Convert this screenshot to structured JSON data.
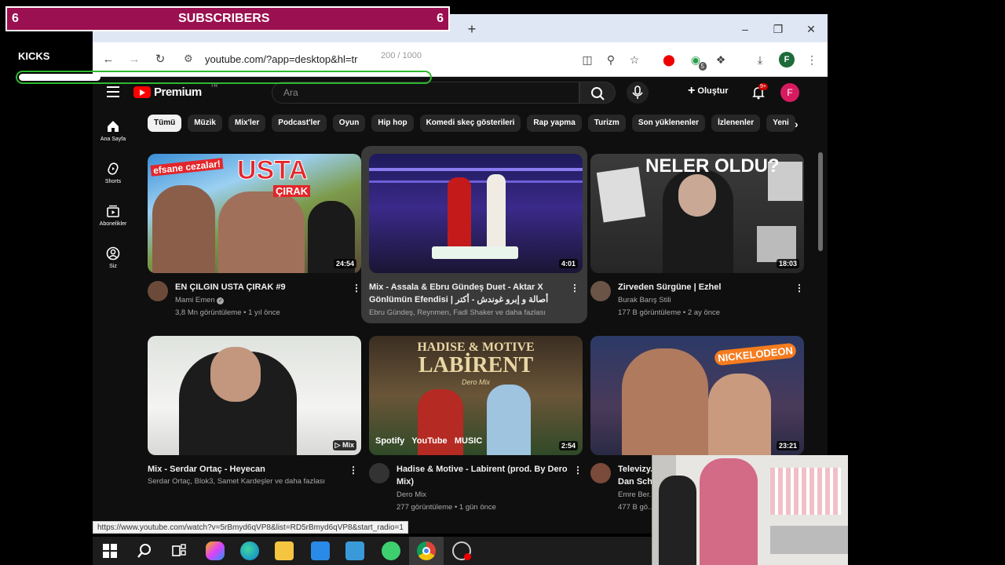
{
  "overlay": {
    "subscribers_label": "SUBSCRIBERS",
    "subscribers_left": "6",
    "subscribers_right": "6",
    "kicks_label": "KICKS",
    "kicks_count": "200 / 1000",
    "kicks_progress": 0.2
  },
  "browser": {
    "url": "youtube.com/?app=desktop&hl=tr",
    "extension_badge": "5",
    "profile_initial": "F",
    "status_url": "https://www.youtube.com/watch?v=5rBmyd6qVP8&list=RD5rBmyd6qVP8&start_radio=1"
  },
  "youtube": {
    "logo_text": "Premium",
    "logo_region": "TR",
    "search_placeholder": "Ara",
    "create_label": "Oluştur",
    "notif_count": "9+",
    "avatar_initial": "F",
    "sidebar": [
      {
        "label": "Ana Sayfa",
        "icon": "home-icon"
      },
      {
        "label": "Shorts",
        "icon": "shorts-icon"
      },
      {
        "label": "Abonelikler",
        "icon": "subscriptions-icon"
      },
      {
        "label": "Siz",
        "icon": "you-icon"
      }
    ],
    "chips": [
      "Tümü",
      "Müzik",
      "Mix'ler",
      "Podcast'ler",
      "Oyun",
      "Hip hop",
      "Komedi skeç gösterileri",
      "Rap yapma",
      "Turizm",
      "Son yüklenenler",
      "İzlenenler",
      "Yeni"
    ],
    "videos": [
      {
        "title": "EN ÇILGIN USTA ÇIRAK #9",
        "channel": "Mami Emen",
        "meta": "3,8 Mn görüntüleme • 1 yıl önce",
        "duration": "24:54",
        "thumb_text": "USTA",
        "thumb_sub": "ÇIRAK",
        "thumb_tag": "efsane cezalar!"
      },
      {
        "title": "Mix - Assala & Ebru Gündeş Duet - Aktar X Gönlümün Efendisi | أصالة و إبرو غوندش - أكتر",
        "channel": "Ebru Gündeş, Reynmen, Fadl Shaker ve daha fazlası",
        "meta": "",
        "duration": "4:01"
      },
      {
        "title": "Zirveden Sürgüne | Ezhel",
        "channel": "Burak Barış Stili",
        "meta": "177 B görüntüleme • 2 ay önce",
        "duration": "18:03",
        "thumb_text": "NELER OLDU?"
      },
      {
        "title": "Mix - Serdar Ortaç - Heyecan",
        "channel": "Serdar Ortaç, Blok3, Samet Kardeşler ve daha fazlası",
        "meta": "",
        "duration": "Mix"
      },
      {
        "title": "Hadise & Motive - Labirent (prod. By Dero Mix)",
        "channel": "Dero Mix",
        "meta": "277 görüntüleme • 1 gün önce",
        "duration": "2:54",
        "thumb_text": "LABİRENT",
        "thumb_sub": "HADISE & MOTIVE",
        "thumb_tag": "Dero Mix",
        "thumb_brands": "Spotify   YouTube   MUSIC"
      },
      {
        "title": "Televizy...",
        "title_line2": "Dan Sch...",
        "channel": "Emre Ber...",
        "meta": "477 B gö...",
        "duration": "23:21",
        "thumb_text": "NICKELODEON"
      }
    ]
  },
  "colors": {
    "sub_bg": "#9b1050",
    "kicks_border": "#2eb82e",
    "yt_bg": "#0f0f0f"
  }
}
